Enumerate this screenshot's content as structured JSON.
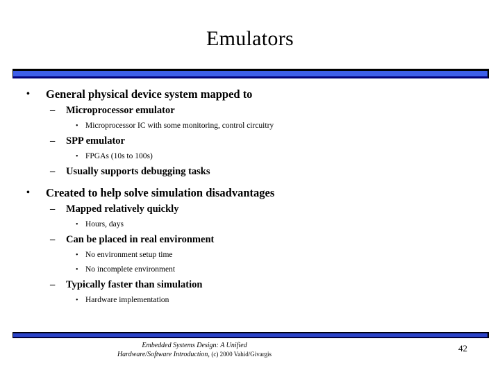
{
  "slide": {
    "title": "Emulators",
    "accent_color": "#3d5fea",
    "text_color": "#000000",
    "background_color": "#ffffff",
    "outline": [
      {
        "level": 1,
        "bullet_glyph": "•",
        "text": "General physical device system mapped to"
      },
      {
        "level": 2,
        "bullet_glyph": "–",
        "text": "Microprocessor emulator"
      },
      {
        "level": 3,
        "bullet_glyph": "•",
        "text": "Microprocessor IC with some monitoring, control circuitry"
      },
      {
        "level": 2,
        "bullet_glyph": "–",
        "text": "SPP emulator"
      },
      {
        "level": 3,
        "bullet_glyph": "•",
        "text": "FPGAs (10s to 100s)"
      },
      {
        "level": 2,
        "bullet_glyph": "–",
        "text": "Usually supports debugging tasks"
      },
      {
        "level": 1,
        "bullet_glyph": "•",
        "text": "Created to help solve simulation disadvantages"
      },
      {
        "level": 2,
        "bullet_glyph": "–",
        "text": "Mapped relatively quickly"
      },
      {
        "level": 3,
        "bullet_glyph": "•",
        "text": "Hours, days"
      },
      {
        "level": 2,
        "bullet_glyph": "–",
        "text": "Can be placed in real environment"
      },
      {
        "level": 3,
        "bullet_glyph": "•",
        "text": "No environment setup time"
      },
      {
        "level": 3,
        "bullet_glyph": "•",
        "text": "No incomplete environment"
      },
      {
        "level": 2,
        "bullet_glyph": "–",
        "text": "Typically faster than simulation"
      },
      {
        "level": 3,
        "bullet_glyph": "•",
        "text": "Hardware implementation"
      }
    ]
  },
  "footer": {
    "book_line1": "Embedded Systems Design: A Unified",
    "book_line2": "Hardware/Software Introduction,",
    "copyright": "(c) 2000 Vahid/Givargis",
    "page_number": "42"
  }
}
